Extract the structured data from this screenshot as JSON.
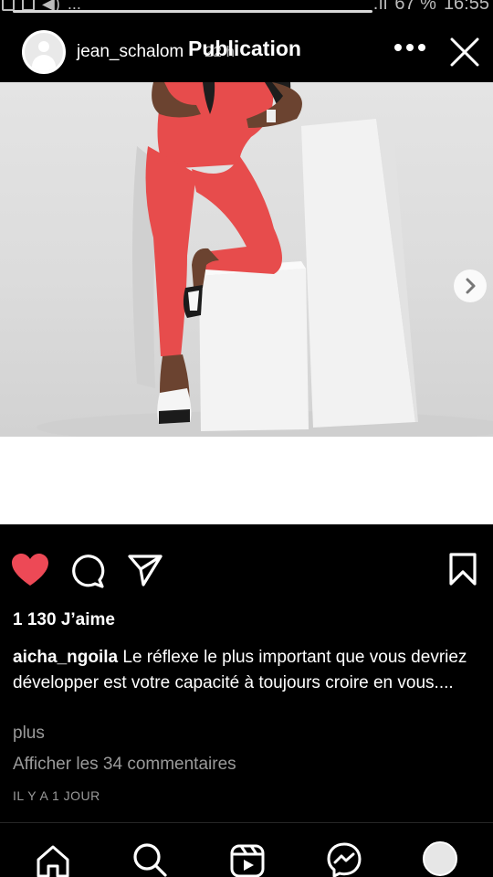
{
  "status_bar": {
    "battery": "67 %",
    "time": "16:55",
    "more": "..."
  },
  "header": {
    "username": "jean_schalom",
    "time_ago": "22 h",
    "title": "Publication"
  },
  "post": {
    "likes": "1 130 J’aime",
    "author": "aicha_ngoila",
    "caption": "Le réflexe le plus important que vous devriez développer est votre capacité à toujours croire en vous....",
    "more": "plus",
    "comments": "Afficher les 34 commentaires",
    "date": "IL Y A 1 JOUR"
  },
  "icons": {
    "like": "heart-icon",
    "comment": "comment-icon",
    "share": "send-icon",
    "save": "bookmark-icon",
    "next": "chevron-right-icon",
    "close": "close-icon",
    "more": "more-icon",
    "nav": [
      "home-icon",
      "search-icon",
      "reels-icon",
      "messenger-icon",
      "profile-avatar"
    ]
  },
  "colors": {
    "like": "#ed4956",
    "jumpsuit": "#e74c4c",
    "background": "#000000"
  }
}
